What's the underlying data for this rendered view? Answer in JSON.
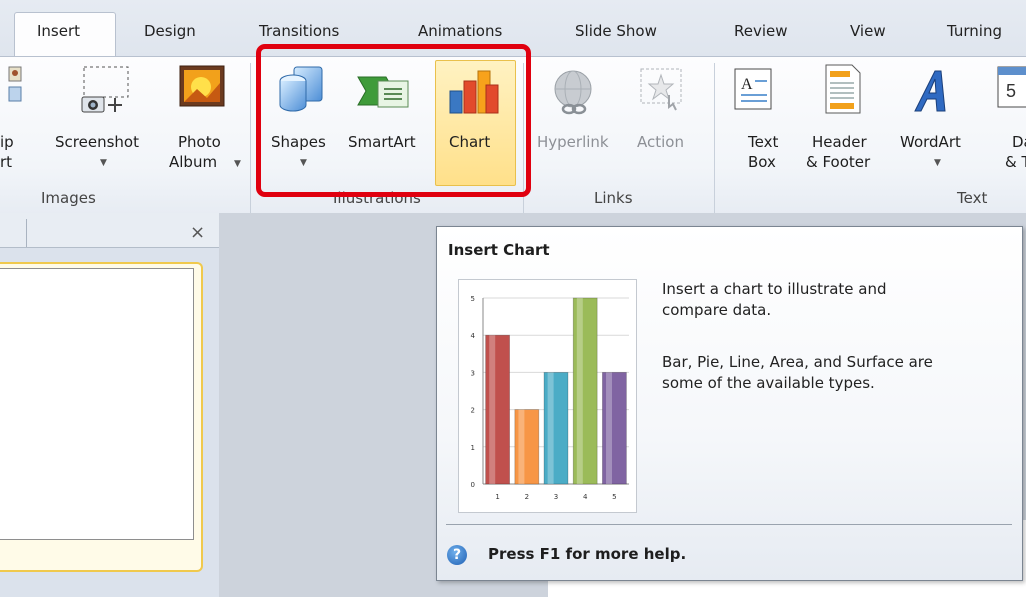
{
  "tabs": [
    {
      "label": "Insert",
      "active": true
    },
    {
      "label": "Design"
    },
    {
      "label": "Transitions"
    },
    {
      "label": "Animations"
    },
    {
      "label": "Slide Show"
    },
    {
      "label": "Review"
    },
    {
      "label": "View"
    },
    {
      "label": "Turning"
    }
  ],
  "ribbon": {
    "images": {
      "group_label": "Images",
      "clip_line1": "ip",
      "clip_line2": "rt",
      "screenshot": "Screenshot",
      "photo_line1": "Photo",
      "photo_line2": "Album"
    },
    "illustrations": {
      "group_label": "Illustrations",
      "shapes": "Shapes",
      "smartart": "SmartArt",
      "chart": "Chart"
    },
    "links": {
      "group_label": "Links",
      "hyperlink": "Hyperlink",
      "action": "Action"
    },
    "text": {
      "group_label": "Text",
      "textbox_line1": "Text",
      "textbox_line2": "Box",
      "header_line1": "Header",
      "header_line2": "& Footer",
      "wordart": "WordArt",
      "date_line1": "Da",
      "date_line2": "& T"
    },
    "accent_highlight": "#e0000f"
  },
  "panes": {
    "close_glyph": "×"
  },
  "tooltip": {
    "title": "Insert Chart",
    "desc1_line1": "Insert a chart to illustrate and",
    "desc1_line2": "compare data.",
    "desc2_line1": "Bar, Pie, Line, Area, and Surface are",
    "desc2_line2": "some of the available types.",
    "help": "Press F1 for more help.",
    "help_icon": "?"
  },
  "chart_data": {
    "type": "bar",
    "categories": [
      "1",
      "2",
      "3",
      "4",
      "5"
    ],
    "values": [
      4,
      2,
      3,
      5,
      3
    ],
    "ylim": [
      0,
      5
    ],
    "yticks": [
      "0",
      "1",
      "2",
      "3",
      "4",
      "5"
    ],
    "colors": [
      "#c0504d",
      "#f79646",
      "#4bacc6",
      "#9bbb59",
      "#8064a2"
    ],
    "grid": true
  }
}
